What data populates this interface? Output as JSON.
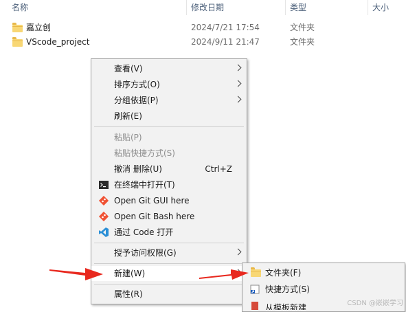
{
  "columns": {
    "name": "名称",
    "date": "修改日期",
    "type": "类型",
    "size": "大小"
  },
  "files": [
    {
      "name": "嘉立创",
      "date": "2024/7/21 17:54",
      "type": "文件夹"
    },
    {
      "name": "VScode_project",
      "date": "2024/9/11 21:47",
      "type": "文件夹"
    }
  ],
  "context_menu": {
    "view": "查看(V)",
    "sort": "排序方式(O)",
    "group": "分组依据(P)",
    "refresh": "刷新(E)",
    "paste": "粘贴(P)",
    "paste_shortcut": "粘贴快捷方式(S)",
    "undo": "撤消 删除(U)",
    "undo_shortcut": "Ctrl+Z",
    "open_terminal": "在终端中打开(T)",
    "git_gui": "Open Git GUI here",
    "git_bash": "Open Git Bash here",
    "open_code": "通过 Code 打开",
    "grant_access": "授予访问权限(G)",
    "new": "新建(W)",
    "properties": "属性(R)"
  },
  "submenu": {
    "folder": "文件夹(F)",
    "shortcut": "快捷方式(S)",
    "partial": "从模板新建"
  },
  "watermark": "CSDN @嵌嵌学习",
  "colors": {
    "menu_bg": "#f2f2f2",
    "arrow": "#e8281e",
    "folder": "#f8d775",
    "vscode": "#2b8fd6",
    "git": "#f05133"
  }
}
